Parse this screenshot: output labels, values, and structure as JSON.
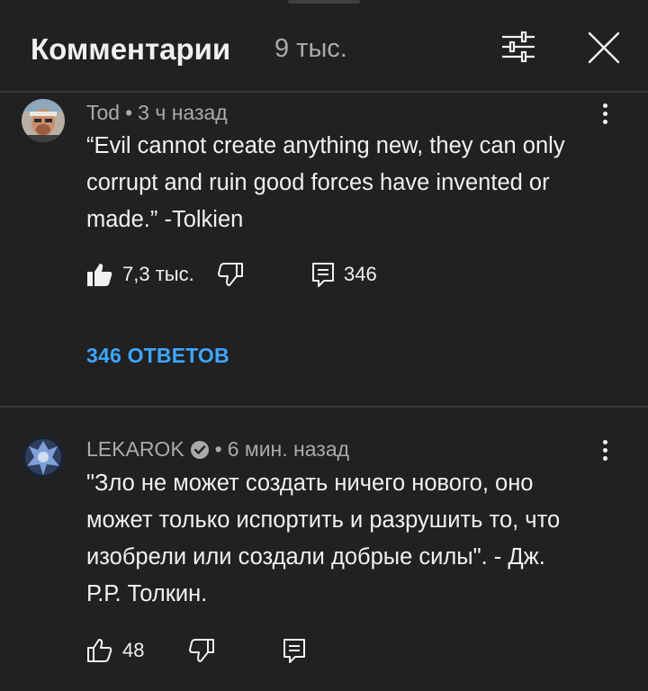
{
  "header": {
    "title": "Комментарии",
    "count": "9 тыс."
  },
  "icons": {
    "filter": "sliders-icon",
    "close": "close-icon",
    "like": "thumbs-up-icon",
    "dislike": "thumbs-down-icon",
    "reply": "comment-icon",
    "more": "more-vert-icon",
    "verified": "verified-check-icon"
  },
  "colors": {
    "background": "#212121",
    "text": "#f1f1f1",
    "secondary_text": "#aaaaaa",
    "link": "#3ea6ff"
  },
  "comments": [
    {
      "author": "Tod",
      "separator": "•",
      "time": "3 ч назад",
      "verified": false,
      "text": "“Evil cannot create anything new, they can only\ncorrupt and ruin good forces have invented or\nmade.” -Tolkien",
      "likes": "7,3 тыс.",
      "liked": true,
      "replies_count": "346",
      "replies_label": "346 ОТВЕТОВ"
    },
    {
      "author": "LEKAROK",
      "separator": "•",
      "time": "6 мин. назад",
      "verified": true,
      "text": "\"Зло не может создать ничего нового, оно\nможет только испортить и разрушить то, что\nизобрели или создали добрые силы\". - Дж.\nР.Р. Толкин.",
      "likes": "48",
      "liked": false
    }
  ]
}
